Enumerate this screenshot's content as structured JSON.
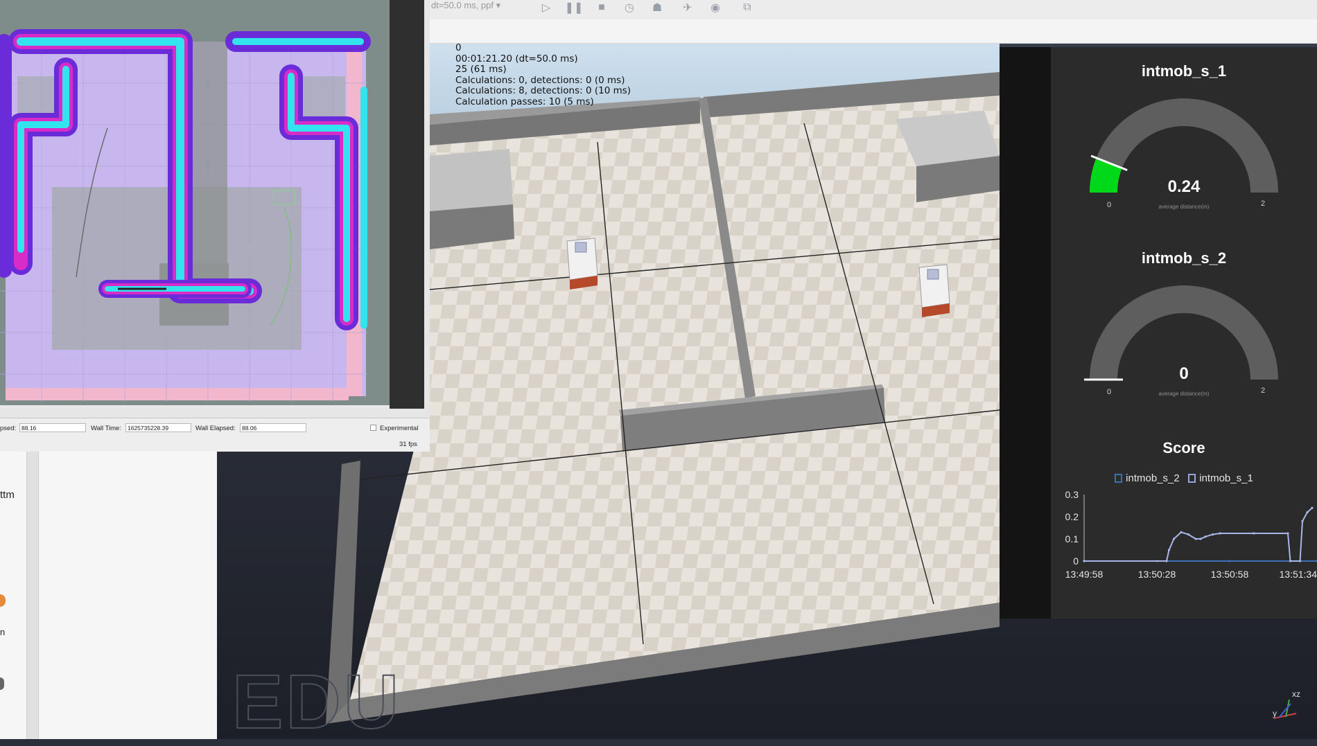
{
  "sim": {
    "dt_select": "dt=50.0 ms, ppf",
    "info_lines": [
      "0",
      "00:01:21.20 (dt=50.0 ms)",
      "25 (61 ms)",
      "Calculations: 0, detections: 0 (0 ms)",
      "Calculations: 8, detections: 0 (10 ms)",
      "Calculation passes: 10 (5 ms)"
    ],
    "toolbar_icons": [
      "play-icon",
      "pause-icon",
      "stop-icon",
      "clock-icon",
      "turtle-icon",
      "rabbit-icon",
      "eye-icon",
      "camera-icon"
    ]
  },
  "map_status": {
    "sim_elapsed_label": "psed:",
    "sim_elapsed": "88.16",
    "wall_time_label": "Wall Time:",
    "wall_time": "1625735228.39",
    "wall_elapsed_label": "Wall Elapsed:",
    "wall_elapsed": "88.06",
    "experimental_label": "Experimental",
    "fps": "31 fps"
  },
  "left_panel": {
    "text": "ttm",
    "text2": "n"
  },
  "dashboard": {
    "gauge1": {
      "title": "intmob_s_1",
      "value": "0.24",
      "value_num": 0.24,
      "min": "0",
      "max": "2",
      "sub": "average distance(m)",
      "color": "#00d81a"
    },
    "gauge2": {
      "title": "intmob_s_2",
      "value": "0",
      "value_num": 0,
      "min": "0",
      "max": "2",
      "sub": "average distance(m)",
      "color": "#00d81a"
    },
    "score": {
      "title": "Score",
      "legend": [
        "intmob_s_2",
        "intmob_s_1"
      ]
    }
  },
  "chart_data": {
    "type": "line",
    "title": "Score",
    "x": [
      "13:49:58",
      "13:50:28",
      "13:50:58",
      "13:51:34"
    ],
    "ylim": [
      0,
      0.3
    ],
    "yticks": [
      "0",
      "0.1",
      "0.2",
      "0.3"
    ],
    "xticks": [
      "13:49:58",
      "13:50:28",
      "13:50:58",
      "13:51:34"
    ],
    "series": [
      {
        "name": "intmob_s_2",
        "color": "#3d6fb8",
        "points": [
          [
            0,
            0
          ],
          [
            30,
            0
          ],
          [
            60,
            0
          ],
          [
            96,
            0
          ]
        ]
      },
      {
        "name": "intmob_s_1",
        "color": "#a9b7e8",
        "points": [
          [
            0,
            0
          ],
          [
            34,
            0
          ],
          [
            35,
            0.05
          ],
          [
            37,
            0.1
          ],
          [
            40,
            0.13
          ],
          [
            43,
            0.12
          ],
          [
            46,
            0.1
          ],
          [
            48,
            0.1
          ],
          [
            50,
            0.11
          ],
          [
            53,
            0.12
          ],
          [
            56,
            0.125
          ],
          [
            70,
            0.125
          ],
          [
            84,
            0.125
          ],
          [
            85,
            0
          ],
          [
            89,
            0
          ],
          [
            90,
            0.18
          ],
          [
            92,
            0.22
          ],
          [
            94,
            0.24
          ]
        ]
      }
    ],
    "grid": false,
    "legend": "top"
  }
}
